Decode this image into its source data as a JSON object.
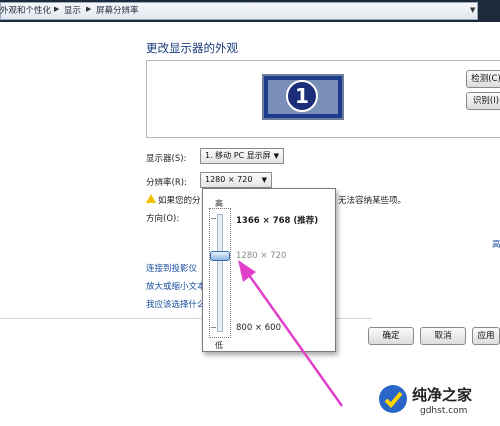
{
  "breadcrumb": {
    "items": [
      "外观和个性化",
      "显示",
      "屏幕分辨率"
    ]
  },
  "page_title": "更改显示器的外观",
  "preview": {
    "monitor_number": "1",
    "detect_button": "检测(C)",
    "identify_button": "识别(I)"
  },
  "display": {
    "label": "显示器(S):",
    "value": "1. 移动 PC 显示屏"
  },
  "resolution": {
    "label": "分辨率(R):",
    "value": "1280 × 720"
  },
  "warning": {
    "prefix": "如果您的分",
    "suffix": "无法容纳某些项。"
  },
  "orientation": {
    "label": "方向(O):"
  },
  "advanced_link_fragment": "高",
  "links": [
    "连接到投影仪",
    "放大或缩小文本",
    "我应该选择什么"
  ],
  "footer": {
    "ok": "确定",
    "cancel": "取消",
    "apply": "应用"
  },
  "resolution_popup": {
    "high_label": "高",
    "low_label": "低",
    "options": [
      "1366 × 768 (推荐)",
      "1280 × 720",
      "800 × 600"
    ],
    "selected_option": "1280 × 720"
  },
  "watermark": {
    "brand": "纯净之家",
    "url": "gdhst.com"
  },
  "colors": {
    "link": "#1a4fa0",
    "annotation_arrow": "#e040c8",
    "title": "#1a3a7a"
  }
}
